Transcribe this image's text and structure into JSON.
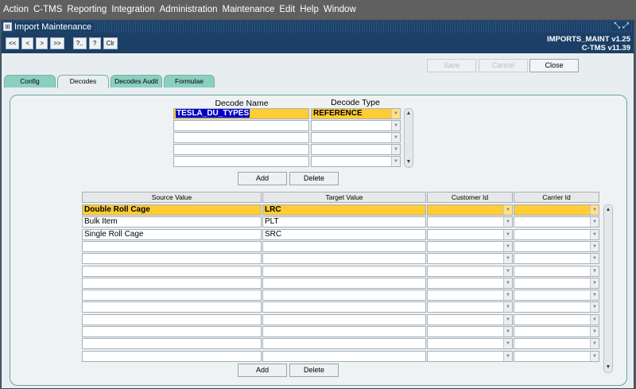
{
  "menu": [
    "Action",
    "C-TMS",
    "Reporting",
    "Integration",
    "Administration",
    "Maintenance",
    "Edit",
    "Help",
    "Window"
  ],
  "window": {
    "title": "Import Maintenance",
    "version_line1": "IMPORTS_MAINT v1.25",
    "version_line2": "C-TMS v11.39"
  },
  "toolbar": {
    "first": "<<",
    "prev": "<",
    "next": ">",
    "last": ">>",
    "query": "?..",
    "help": "?",
    "clear": "Clr"
  },
  "actions": {
    "save": "Save",
    "cancel": "Cancel",
    "close": "Close"
  },
  "tabs": [
    "Config",
    "Decodes",
    "Decodes Audit",
    "Formulae"
  ],
  "decode_grid": {
    "name_header": "Decode Name",
    "type_header": "Decode Type",
    "rows": [
      {
        "name": "TESLA_DU_TYPES",
        "type": "REFERENCE"
      },
      {
        "name": "",
        "type": ""
      },
      {
        "name": "",
        "type": ""
      },
      {
        "name": "",
        "type": ""
      },
      {
        "name": "",
        "type": ""
      }
    ],
    "add_label": "Add",
    "delete_label": "Delete"
  },
  "value_grid": {
    "headers": [
      "Source Value",
      "Target Value",
      "Customer Id",
      "Carrier Id"
    ],
    "rows": [
      {
        "source": "Double Roll Cage",
        "target": "LRC",
        "customer": "",
        "carrier": ""
      },
      {
        "source": "Bulk Item",
        "target": "PLT",
        "customer": "",
        "carrier": ""
      },
      {
        "source": "Single Roll Cage",
        "target": "SRC",
        "customer": "",
        "carrier": ""
      },
      {
        "source": "",
        "target": "",
        "customer": "",
        "carrier": ""
      },
      {
        "source": "",
        "target": "",
        "customer": "",
        "carrier": ""
      },
      {
        "source": "",
        "target": "",
        "customer": "",
        "carrier": ""
      },
      {
        "source": "",
        "target": "",
        "customer": "",
        "carrier": ""
      },
      {
        "source": "",
        "target": "",
        "customer": "",
        "carrier": ""
      },
      {
        "source": "",
        "target": "",
        "customer": "",
        "carrier": ""
      },
      {
        "source": "",
        "target": "",
        "customer": "",
        "carrier": ""
      },
      {
        "source": "",
        "target": "",
        "customer": "",
        "carrier": ""
      },
      {
        "source": "",
        "target": "",
        "customer": "",
        "carrier": ""
      },
      {
        "source": "",
        "target": "",
        "customer": "",
        "carrier": ""
      }
    ],
    "add_label": "Add",
    "delete_label": "Delete"
  }
}
